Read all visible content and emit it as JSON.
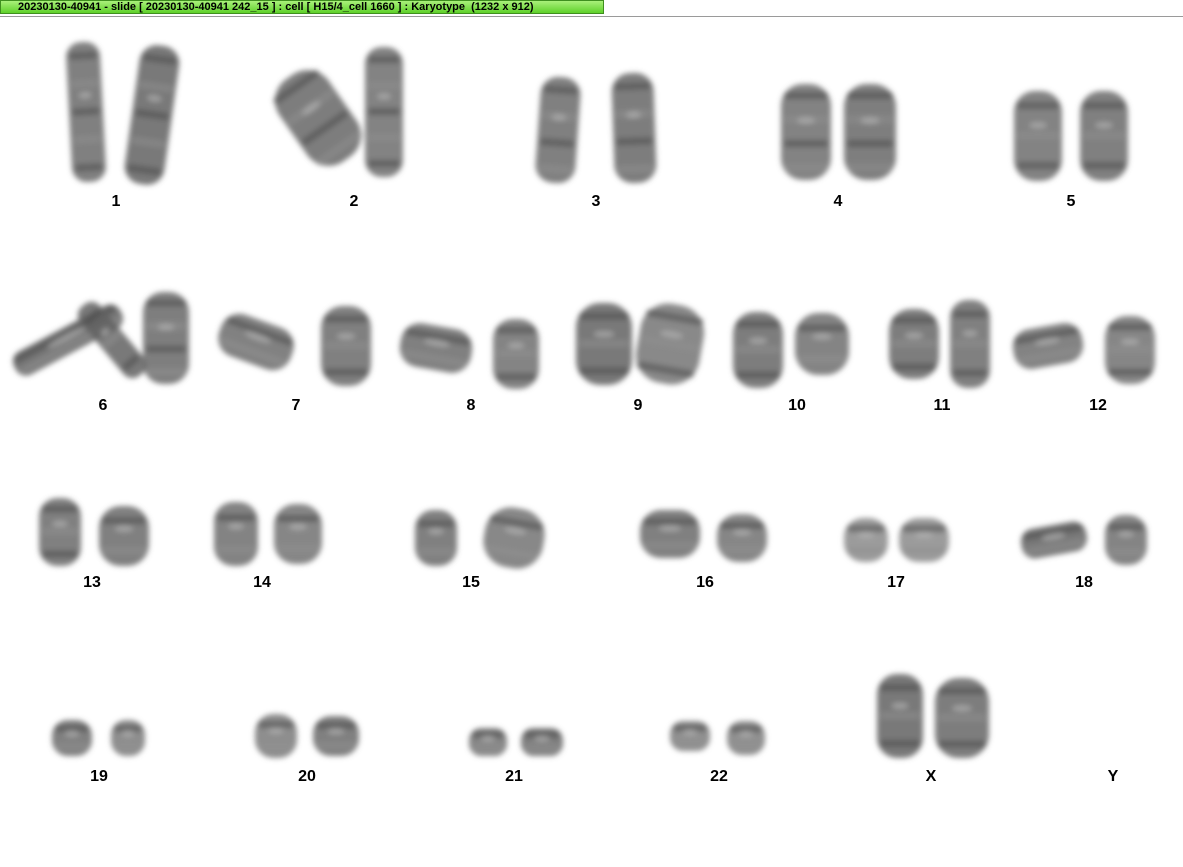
{
  "window": {
    "title": "20230130-40941 - slide [ 20230130-40941 242_15 ] : cell [ H15/4_cell 1660 ] : Karyotype  (1232 x 912)",
    "accent_color": "#6ad93a"
  },
  "karyotype": {
    "chromosomes": [
      {
        "id": "1",
        "label": "1"
      },
      {
        "id": "2",
        "label": "2"
      },
      {
        "id": "3",
        "label": "3"
      },
      {
        "id": "4",
        "label": "4"
      },
      {
        "id": "5",
        "label": "5"
      },
      {
        "id": "6",
        "label": "6"
      },
      {
        "id": "7",
        "label": "7"
      },
      {
        "id": "8",
        "label": "8"
      },
      {
        "id": "9",
        "label": "9"
      },
      {
        "id": "10",
        "label": "10"
      },
      {
        "id": "11",
        "label": "11"
      },
      {
        "id": "12",
        "label": "12"
      },
      {
        "id": "13",
        "label": "13"
      },
      {
        "id": "14",
        "label": "14"
      },
      {
        "id": "15",
        "label": "15"
      },
      {
        "id": "16",
        "label": "16"
      },
      {
        "id": "17",
        "label": "17"
      },
      {
        "id": "18",
        "label": "18"
      },
      {
        "id": "19",
        "label": "19"
      },
      {
        "id": "20",
        "label": "20"
      },
      {
        "id": "21",
        "label": "21"
      },
      {
        "id": "22",
        "label": "22"
      },
      {
        "id": "x",
        "label": "X"
      },
      {
        "id": "y",
        "label": "Y"
      }
    ]
  }
}
